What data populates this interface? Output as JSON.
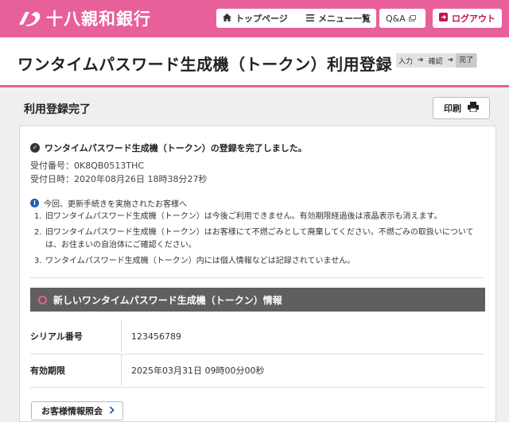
{
  "header": {
    "logo_text": "十八親和銀行",
    "brand_color": "#e8609a",
    "buttons": {
      "top": "トップページ",
      "menu": "メニュー一覧",
      "qa": "Q&A",
      "logout": "ログアウト"
    }
  },
  "title": {
    "text": "ワンタイムパスワード生成機（トークン）利用登録",
    "steps": [
      "入力",
      "確認",
      "完了"
    ],
    "current_step": "完了"
  },
  "section": {
    "title": "利用登録完了",
    "print_label": "印刷"
  },
  "result": {
    "message": "ワンタイムパスワード生成機（トークン）の登録を完了しました。",
    "receipt_no": "受付番号：0K8QB0513THC",
    "receipt_date": "受付日時：2020年08月26日 18時38分27秒"
  },
  "notice": {
    "heading": "今回、更新手続きを実施されたお客様へ",
    "items": [
      {
        "num": "1.",
        "text": "旧ワンタイムパスワード生成機（トークン）は今後ご利用できません。有効期限経過後は液晶表示も消えます。"
      },
      {
        "num": "2.",
        "text": "旧ワンタイムパスワード生成機（トークン）はお客様にて不燃ごみとして廃棄してください。不燃ごみの取扱いについては、お住まいの自治体にご確認ください。"
      },
      {
        "num": "3.",
        "text": "ワンタイムパスワード生成機（トークン）内には個人情報などは記録されていません。"
      }
    ]
  },
  "token_info": {
    "heading": "新しいワンタイムパスワード生成機（トークン）情報",
    "serial_label": "シリアル番号",
    "serial_value": "123456789",
    "expiry_label": "有効期限",
    "expiry_value": "2025年03月31日 09時00分00秒"
  },
  "footer": {
    "customer_button": "お客様情報照会"
  }
}
